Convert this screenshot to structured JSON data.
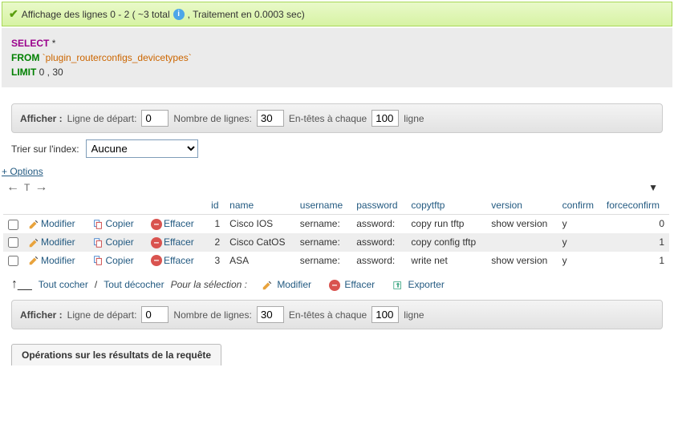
{
  "status": {
    "prefix": "Affichage des lignes 0 - 2 ( ~3 total ",
    "suffix": " , Traitement en 0.0003 sec)"
  },
  "sql": {
    "select": "SELECT",
    "star": "*",
    "from": "FROM",
    "table": "`plugin_routerconfigs_devicetypes`",
    "limit": "LIMIT",
    "limit_vals": "0 , 30"
  },
  "toolbar": {
    "show": "Afficher :",
    "start_label": "Ligne de départ:",
    "start_val": "0",
    "count_label": "Nombre de lignes:",
    "count_val": "30",
    "headers_label": "En-têtes à chaque",
    "headers_val": "100",
    "line": "ligne"
  },
  "sort": {
    "label": "Trier sur l'index:",
    "value": "Aucune"
  },
  "options_label": "+ Options",
  "nav": {
    "left": "←",
    "t": "T",
    "right": "→",
    "drop": "▼"
  },
  "columns": [
    "id",
    "name",
    "username",
    "password",
    "copytftp",
    "version",
    "confirm",
    "forceconfirm"
  ],
  "actions": {
    "edit": "Modifier",
    "copy": "Copier",
    "delete": "Effacer"
  },
  "rows": [
    {
      "id": "1",
      "name": "Cisco IOS",
      "username": "sername:",
      "password": "assword:",
      "copytftp": "copy run tftp",
      "version": "show version",
      "confirm": "y",
      "forceconfirm": "0"
    },
    {
      "id": "2",
      "name": "Cisco CatOS",
      "username": "sername:",
      "password": "assword:",
      "copytftp": "copy config tftp",
      "version": "",
      "confirm": "y",
      "forceconfirm": "1"
    },
    {
      "id": "3",
      "name": "ASA",
      "username": "sername:",
      "password": "assword:",
      "copytftp": "write net",
      "version": "show version",
      "confirm": "y",
      "forceconfirm": "1"
    }
  ],
  "footer": {
    "check_all": "Tout cocher",
    "uncheck_all": "Tout décocher",
    "for_selection": "Pour la sélection :",
    "edit": "Modifier",
    "delete": "Effacer",
    "export": "Exporter"
  },
  "ops_tab": "Opérations sur les résultats de la requête"
}
